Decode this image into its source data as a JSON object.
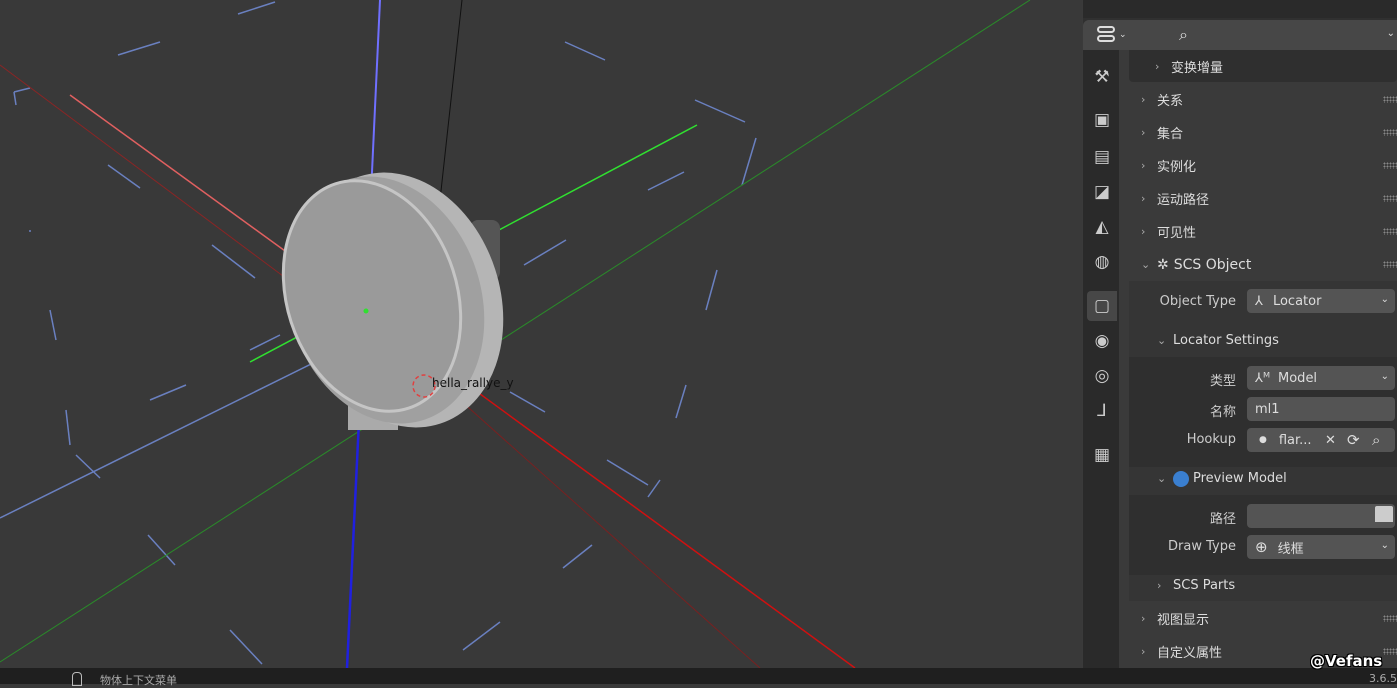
{
  "viewport": {
    "object_label": "hella_rallye_y"
  },
  "status": {
    "context_menu": "物体上下文菜单",
    "version": "3.6.5"
  },
  "panel": {
    "header": {
      "editor_icon": "properties-editor-icon",
      "search_icon": "search-icon"
    },
    "tabs": [
      "tool",
      "render",
      "output",
      "view-layer",
      "scene",
      "world",
      "object",
      "physics",
      "constraints",
      "object-data",
      "texture"
    ],
    "sections": [
      {
        "label": "变换增量",
        "expanded": false
      },
      {
        "label": "关系",
        "expanded": false
      },
      {
        "label": "集合",
        "expanded": false
      },
      {
        "label": "实例化",
        "expanded": false
      },
      {
        "label": "运动路径",
        "expanded": false
      },
      {
        "label": "可见性",
        "expanded": false
      },
      {
        "label": "SCS Object",
        "expanded": true
      }
    ],
    "scs": {
      "object_type_label": "Object Type",
      "object_type_value": "Locator",
      "locator_settings": "Locator Settings",
      "type_label": "类型",
      "type_value": "Model",
      "name_label": "名称",
      "name_value": "ml1",
      "hookup_label": "Hookup",
      "hookup_value": "flar...",
      "preview_model": "Preview Model",
      "preview_color": "#3a7fd0",
      "path_label": "路径",
      "path_value": "",
      "draw_type_label": "Draw Type",
      "draw_type_value": "线框",
      "scs_parts": "SCS Parts"
    },
    "bottom_sections": [
      {
        "label": "视图显示"
      },
      {
        "label": "自定义属性"
      }
    ]
  },
  "watermark": "@Vefans"
}
